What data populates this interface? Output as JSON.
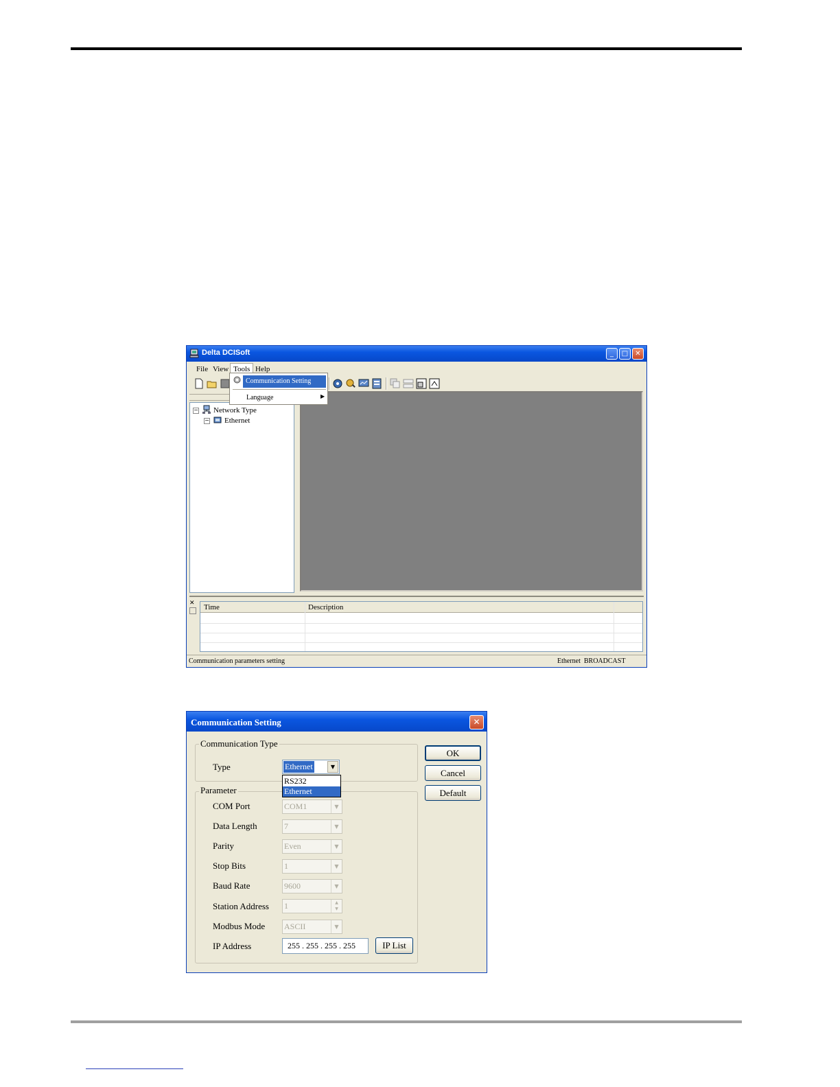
{
  "main_window": {
    "title": "Delta DCISoft",
    "menu": [
      "File",
      "View",
      "Tools",
      "Help"
    ],
    "tools_menu": {
      "items": [
        {
          "label": "Communication Setting",
          "selected": true
        },
        {
          "label": "Language",
          "has_submenu": true
        }
      ]
    },
    "tree": {
      "root": "Network Type",
      "child": "Ethernet"
    },
    "log_table": {
      "columns": [
        "Time",
        "Description"
      ]
    },
    "status": {
      "left": "Communication parameters setting",
      "right": "Ethernet  BROADCAST"
    }
  },
  "dialog": {
    "title": "Communication Setting",
    "comm_type_group": "Communication Type",
    "type_label": "Type",
    "type_value": "Ethernet",
    "type_options": [
      "RS232",
      "Ethernet"
    ],
    "parameter_group": "Parameter",
    "fields": [
      {
        "label": "COM Port",
        "value": "COM1"
      },
      {
        "label": "Data Length",
        "value": "7"
      },
      {
        "label": "Parity",
        "value": "Even"
      },
      {
        "label": "Stop Bits",
        "value": "1"
      },
      {
        "label": "Baud Rate",
        "value": "9600"
      },
      {
        "label": "Station Address",
        "value": "1"
      },
      {
        "label": "Modbus Mode",
        "value": "ASCII"
      }
    ],
    "ip_label": "IP Address",
    "ip_value": "255 . 255 . 255 . 255",
    "ip_list_button": "IP List",
    "ok_button": "OK",
    "cancel_button": "Cancel",
    "default_button": "Default"
  }
}
